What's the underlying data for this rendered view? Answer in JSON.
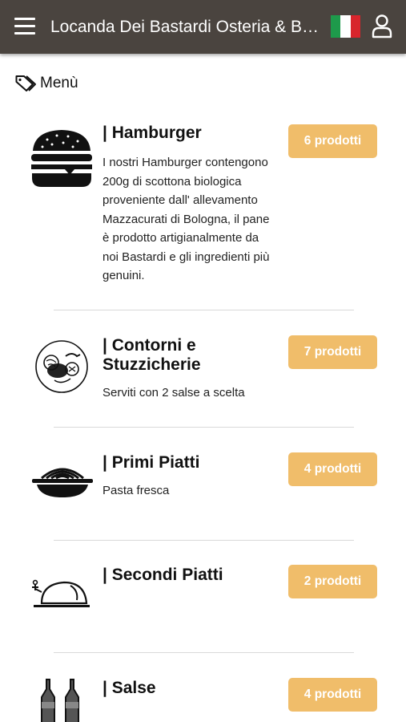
{
  "header": {
    "title": "Locanda Dei Bastardi Osteria & Beer",
    "menu_icon": "hamburger-menu-icon",
    "flag_icon": "italy-flag-icon",
    "user_icon": "user-icon",
    "bar_color": "#4a443f"
  },
  "menu_heading": {
    "label": "Menù",
    "icon": "tag-icon"
  },
  "categories": [
    {
      "title": "| Hamburger",
      "lines": [
        "I nostri Hamburger contengono",
        "200g di scottona biologica",
        "proveniente dall' allevamento",
        "Mazzacurati di Bologna, il pane",
        "è prodotto artigianalmente da",
        "noi Bastardi e gli ingredienti più",
        "genuini."
      ],
      "badge": "6 prodotti",
      "icon": "burger-icon"
    },
    {
      "title_lines": [
        "| Contorni e",
        "Stuzzicherie"
      ],
      "description": "Serviti con 2 salse a scelta",
      "badge": "7 prodotti",
      "icon": "vegetables-icon"
    },
    {
      "title": "| Primi Piatti",
      "description": "Pasta fresca",
      "badge": "4 prodotti",
      "icon": "pasta-bowl-icon"
    },
    {
      "title": "| Secondi Piatti",
      "description": "",
      "badge": "2 prodotti",
      "icon": "roast-chicken-icon"
    },
    {
      "title": "| Salse",
      "description": "",
      "badge": "4 prodotti",
      "icon": "sauce-bottles-icon"
    }
  ],
  "colors": {
    "badge": "#f0bd6a",
    "divider": "#d9d9d9"
  }
}
